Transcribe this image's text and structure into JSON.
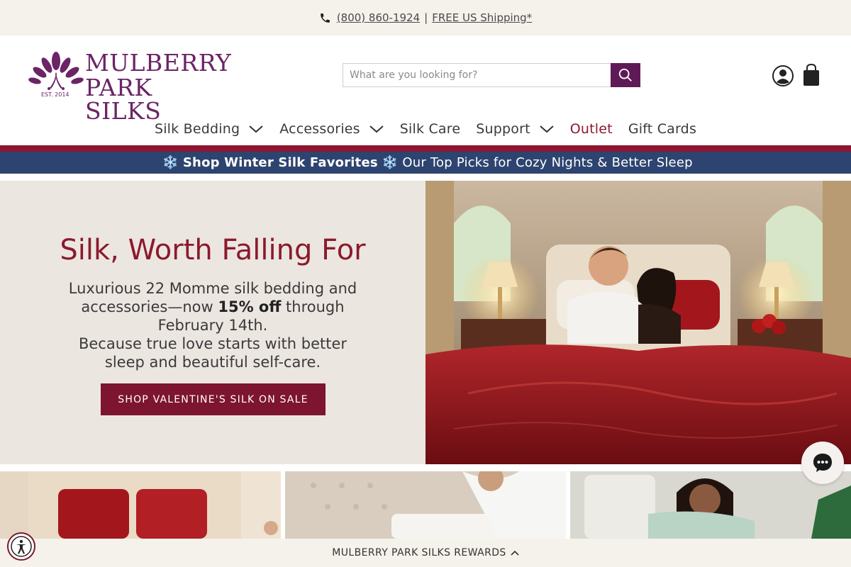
{
  "topbar": {
    "phone": "(800) 860-1924",
    "separator": "|",
    "shipping": "FREE US Shipping*"
  },
  "logo": {
    "line1": "MULBERRY",
    "line2": "PARK SILKS",
    "est": "EST. 2014"
  },
  "search": {
    "placeholder": "What are you looking for?",
    "value": ""
  },
  "nav": {
    "items": [
      {
        "label": "Silk Bedding",
        "has_dropdown": true
      },
      {
        "label": "Accessories",
        "has_dropdown": true
      },
      {
        "label": "Silk Care",
        "has_dropdown": false
      },
      {
        "label": "Support",
        "has_dropdown": true
      },
      {
        "label": "Outlet",
        "has_dropdown": false
      },
      {
        "label": "Gift Cards",
        "has_dropdown": false
      }
    ]
  },
  "promo": {
    "icon": "❄️",
    "bold": "Shop Winter Silk Favorites",
    "rest": "Our Top Picks for Cozy Nights & Better Sleep"
  },
  "hero": {
    "title": "Silk, Worth Falling For",
    "text_part1": "Luxurious 22 Momme silk bedding and accessories—now ",
    "text_bold": "15% off",
    "text_part2": " through February 14th.",
    "text_line2": "Because true love starts with better sleep and beautiful self-care.",
    "button": "SHOP VALENTINE'S SILK ON SALE"
  },
  "rewards": {
    "label": "MULBERRY PARK SILKS REWARDS"
  },
  "colors": {
    "brand_purple": "#5e1a56",
    "accent_red": "#8b1a2b",
    "promo_blue": "#2e4470",
    "cream": "#f5f2ec"
  }
}
